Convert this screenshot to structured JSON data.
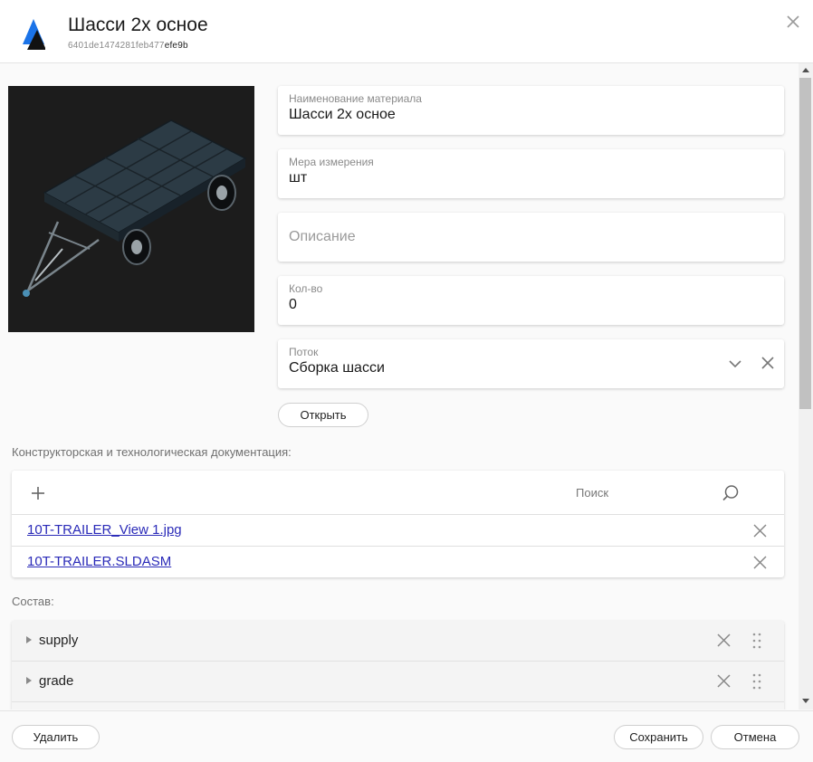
{
  "header": {
    "title": "Шасси 2х осное",
    "id_prefix": "6401de1474281feb477",
    "id_suffix": "efe9b",
    "logo_colors": [
      "#1a73e8",
      "#111111"
    ]
  },
  "form": {
    "name": {
      "label": "Наименование материала",
      "value": "Шасси 2х осное"
    },
    "unit": {
      "label": "Мера измерения",
      "value": "шт"
    },
    "description": {
      "placeholder": "Описание"
    },
    "quantity": {
      "label": "Кол-во",
      "value": "0"
    },
    "flow": {
      "label": "Поток",
      "value": "Сборка шасси"
    },
    "open_label": "Открыть"
  },
  "docs": {
    "section_label": "Конструкторская и технологическая документация:",
    "search_label": "Поиск",
    "files": [
      {
        "name": "10T-TRAILER_View 1.jpg"
      },
      {
        "name": "10T-TRAILER.SLDASM"
      }
    ]
  },
  "composition": {
    "section_label": "Состав:",
    "items": [
      {
        "name": "supply"
      },
      {
        "name": "grade"
      }
    ]
  },
  "footer": {
    "delete_label": "Удалить",
    "save_label": "Сохранить",
    "cancel_label": "Отмена"
  },
  "colors": {
    "accent_blue": "#1a73e8",
    "link": "#2a2ab8",
    "image_bg": "#1c1c1c"
  }
}
